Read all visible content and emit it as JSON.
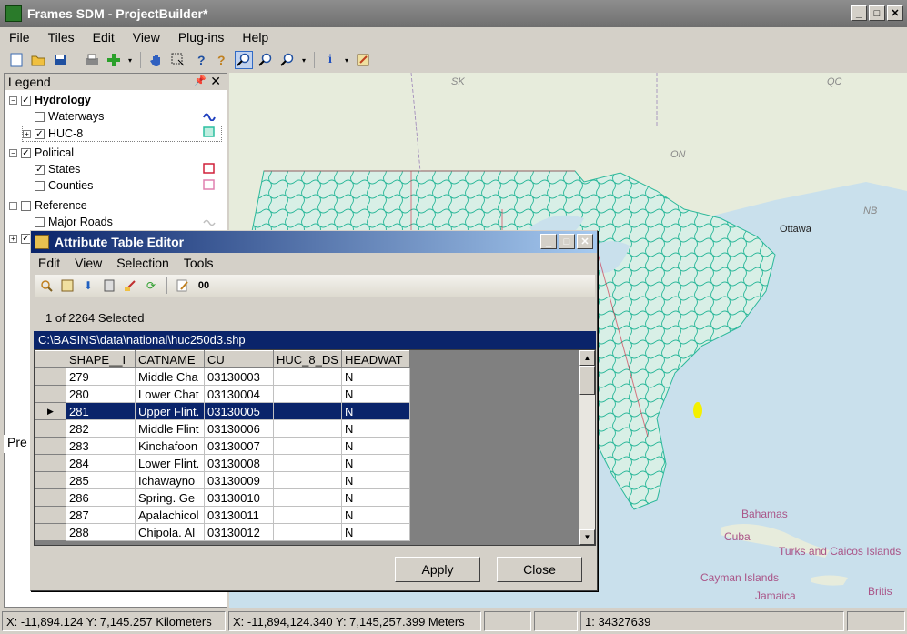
{
  "window": {
    "title": "Frames SDM  - ProjectBuilder*"
  },
  "menu": [
    "File",
    "Tiles",
    "Edit",
    "View",
    "Plug-ins",
    "Help"
  ],
  "toolbar_icons": [
    "new-icon",
    "open-icon",
    "save-icon",
    "print-icon",
    "add-layer-icon",
    "pan-icon",
    "select-icon",
    "query-icon",
    "identify-icon",
    "zoom-in-icon",
    "zoom-out-icon",
    "zoom-menu-icon",
    "info-icon",
    "edit-icon"
  ],
  "legend": {
    "title": "Legend",
    "groups": [
      {
        "label": "Hydrology",
        "checked": true,
        "layers": [
          {
            "label": "Waterways",
            "checked": false,
            "symbol_color": "#1f3fbf"
          },
          {
            "label": "HUC-8",
            "checked": true,
            "symbol_color": "#2bbfa0"
          }
        ]
      },
      {
        "label": "Political",
        "checked": true,
        "layers": [
          {
            "label": "States",
            "checked": true,
            "symbol_color": "#d0203a"
          },
          {
            "label": "Counties",
            "checked": false,
            "symbol_color": "#e080b0"
          }
        ]
      },
      {
        "label": "Reference",
        "checked": false,
        "layers": [
          {
            "label": "Major Roads",
            "checked": false,
            "symbol_color": "#c0c0c0"
          }
        ]
      }
    ],
    "preview_tab": "Pre"
  },
  "map": {
    "labels": [
      "SK",
      "QC",
      "ON",
      "Ottawa",
      "NB",
      "Bahamas",
      "Cuba",
      "Turks and Caicos Islands",
      "Cayman Islands",
      "Jamaica",
      "Britis"
    ]
  },
  "status": {
    "coords_km": "X: -11,894.124 Y: 7,145.257 Kilometers",
    "coords_m": "X: -11,894,124.340 Y: 7,145,257.399 Meters",
    "scale": "1: 34327639"
  },
  "dialog": {
    "title": "Attribute Table Editor",
    "menu": [
      "Edit",
      "View",
      "Selection",
      "Tools"
    ],
    "selection_text": "1 of 2264 Selected",
    "path": "C:\\BASINS\\data\\national\\huc250d3.shp",
    "columns": [
      "SHAPE__I",
      "CATNAME",
      "CU",
      "HUC_8_DS",
      "HEADWAT"
    ],
    "rows": [
      [
        "279",
        "Middle Cha",
        "03130003",
        "",
        "N"
      ],
      [
        "280",
        "Lower Chat",
        "03130004",
        "",
        "N"
      ],
      [
        "281",
        "Upper Flint.",
        "03130005",
        "",
        "N"
      ],
      [
        "282",
        "Middle Flint",
        "03130006",
        "",
        "N"
      ],
      [
        "283",
        "Kinchafoon",
        "03130007",
        "",
        "N"
      ],
      [
        "284",
        "Lower Flint.",
        "03130008",
        "",
        "N"
      ],
      [
        "285",
        "Ichawayno",
        "03130009",
        "",
        "N"
      ],
      [
        "286",
        "Spring. Ge",
        "03130010",
        "",
        "N"
      ],
      [
        "287",
        "Apalachicol",
        "03130011",
        "",
        "N"
      ],
      [
        "288",
        "Chipola. Al",
        "03130012",
        "",
        "N"
      ]
    ],
    "selected_row_index": 2,
    "apply_label": "Apply",
    "close_label": "Close"
  }
}
